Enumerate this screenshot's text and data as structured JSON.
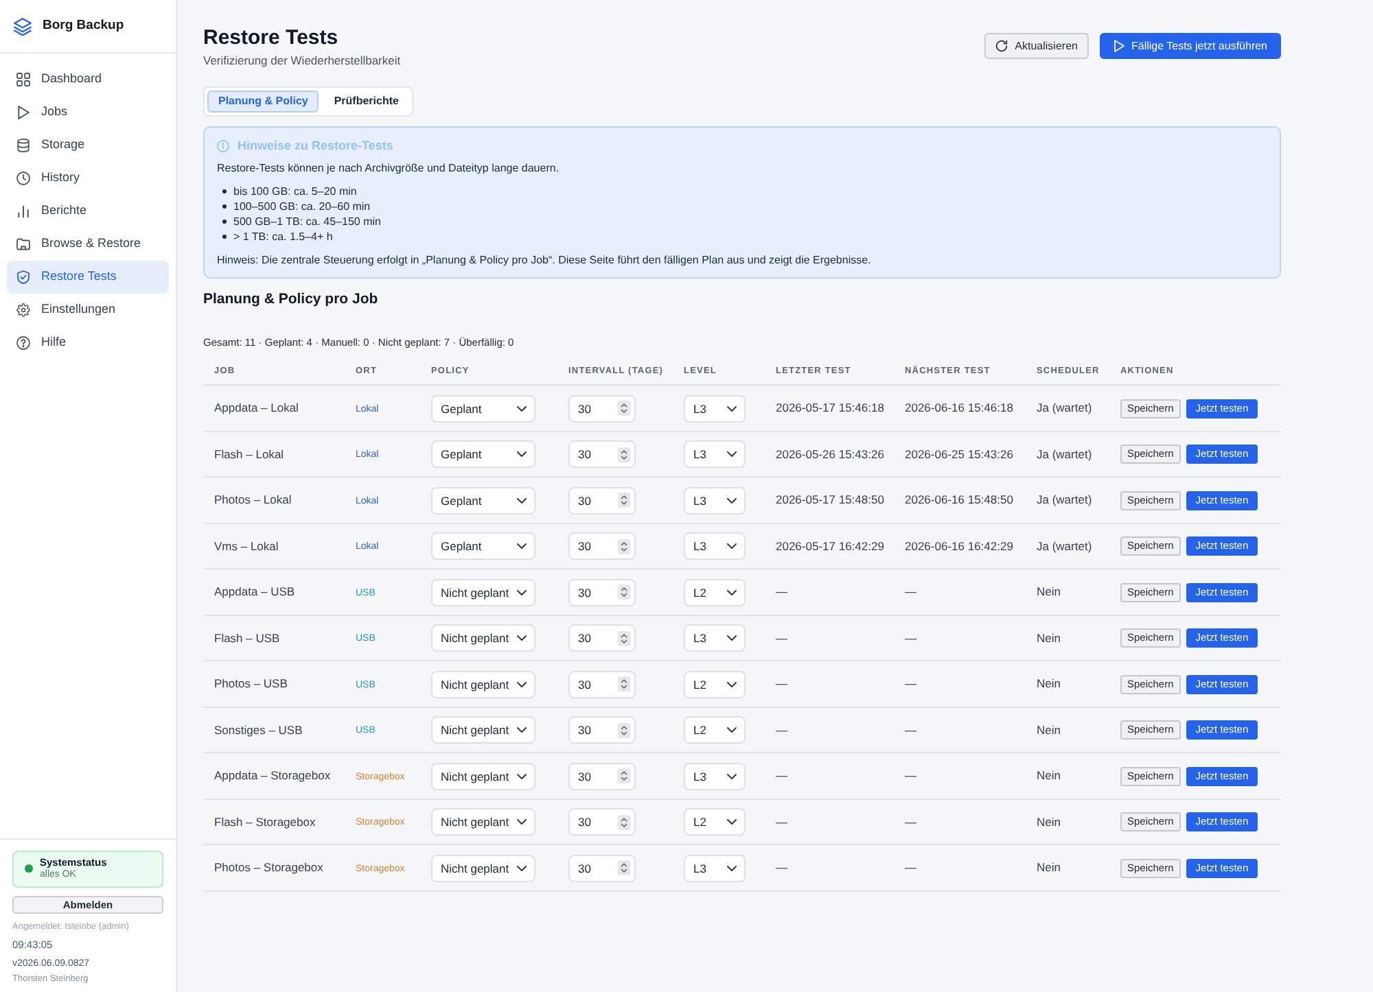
{
  "sidebar": {
    "brand": "Borg Backup",
    "items": [
      {
        "label": "Dashboard",
        "selected": false
      },
      {
        "label": "Jobs",
        "selected": false
      },
      {
        "label": "Storage",
        "selected": false
      },
      {
        "label": "History",
        "selected": false
      },
      {
        "label": "Berichte",
        "selected": false
      },
      {
        "label": "Browse & Restore",
        "selected": false
      },
      {
        "label": "Restore Tests",
        "selected": true
      },
      {
        "label": "Einstellungen",
        "selected": false
      },
      {
        "label": "Hilfe",
        "selected": false
      }
    ],
    "status": {
      "title": "Systemstatus",
      "text": "alles OK"
    },
    "logout_button": "Abmelden",
    "logged_in": "Angemeldet: tsteinbe (admin)",
    "clock": "09:43:05",
    "version": "v2026.06.09.0827",
    "author": "Thorsten Steinberg"
  },
  "header": {
    "title": "Restore Tests",
    "subtitle": "Verifizierung der Wiederherstellbarkeit",
    "buttons": [
      {
        "label": "Aktualisieren",
        "kind": "refresh"
      },
      {
        "label": "Fällige Tests jetzt ausführen",
        "kind": "run"
      }
    ]
  },
  "tabs": [
    {
      "label": "Planung & Policy",
      "selected": true
    },
    {
      "label": "Prüfberichte",
      "selected": false
    }
  ],
  "notice": {
    "title": "Hinweise zu Restore-Tests",
    "intro": "Restore-Tests können je nach Archivgröße und Dateityp lange dauern.",
    "items": [
      "bis 100 GB: ca. 5–20 min",
      "100–500 GB: ca. 20–60 min",
      "500 GB–1 TB: ca. 45–150 min",
      "> 1 TB: ca. 1.5–4+ h"
    ],
    "note": "Hinweis: Die zentrale Steuerung erfolgt in „Planung & Policy pro Job“. Diese Seite führt den fälligen Plan aus und zeigt die Ergebnisse."
  },
  "section_title": "Planung & Policy pro Job",
  "summary": "Gesamt: 11 · Geplant: 4 · Manuell: 0 · Nicht geplant: 7 · Überfällig: 0",
  "table": {
    "columns": [
      "JOB",
      "ORT",
      "POLICY",
      "INTERVALL (TAGE)",
      "LEVEL",
      "LETZTER TEST",
      "NÄCHSTER TEST",
      "SCHEDULER",
      "AKTIONEN"
    ],
    "rows": [
      {
        "job": "Appdata – Lokal",
        "location": {
          "label": "Lokal",
          "color": "#2563eb"
        },
        "policy": "Geplant",
        "interval": "30",
        "test_level": "L3",
        "last_test": "2026-05-17 15:46:18",
        "next_test": "2026-06-16 15:46:18",
        "scheduler": "Ja (wartet)",
        "save": "Speichern",
        "run": "Jetzt testen"
      },
      {
        "job": "Flash – Lokal",
        "location": {
          "label": "Lokal",
          "color": "#2563eb"
        },
        "policy": "Geplant",
        "interval": "30",
        "test_level": "L3",
        "last_test": "2026-05-26 15:43:26",
        "next_test": "2026-06-25 15:43:26",
        "scheduler": "Ja (wartet)",
        "save": "Speichern",
        "run": "Jetzt testen"
      },
      {
        "job": "Photos – Lokal",
        "location": {
          "label": "Lokal",
          "color": "#2563eb"
        },
        "policy": "Geplant",
        "interval": "30",
        "test_level": "L3",
        "last_test": "2026-05-17 15:48:50",
        "next_test": "2026-06-16 15:48:50",
        "scheduler": "Ja (wartet)",
        "save": "Speichern",
        "run": "Jetzt testen"
      },
      {
        "job": "Vms – Lokal",
        "location": {
          "label": "Lokal",
          "color": "#2563eb"
        },
        "policy": "Geplant",
        "interval": "30",
        "test_level": "L3",
        "last_test": "2026-05-17 16:42:29",
        "next_test": "2026-06-16 16:42:29",
        "scheduler": "Ja (wartet)",
        "save": "Speichern",
        "run": "Jetzt testen"
      },
      {
        "job": "Appdata – USB",
        "location": {
          "label": "USB",
          "color": "#1c98d4"
        },
        "policy": "Nicht geplant",
        "interval": "30",
        "test_level": "L2",
        "last_test": "—",
        "next_test": "—",
        "scheduler": "Nein",
        "save": "Speichern",
        "run": "Jetzt testen"
      },
      {
        "job": "Flash – USB",
        "location": {
          "label": "USB",
          "color": "#1c98d4"
        },
        "policy": "Nicht geplant",
        "interval": "30",
        "test_level": "L3",
        "last_test": "—",
        "next_test": "—",
        "scheduler": "Nein",
        "save": "Speichern",
        "run": "Jetzt testen"
      },
      {
        "job": "Photos – USB",
        "location": {
          "label": "USB",
          "color": "#1c98d4"
        },
        "policy": "Nicht geplant",
        "interval": "30",
        "test_level": "L2",
        "last_test": "—",
        "next_test": "—",
        "scheduler": "Nein",
        "save": "Speichern",
        "run": "Jetzt testen"
      },
      {
        "job": "Sonstiges – USB",
        "location": {
          "label": "USB",
          "color": "#1c98d4"
        },
        "policy": "Nicht geplant",
        "interval": "30",
        "test_level": "L2",
        "last_test": "—",
        "next_test": "—",
        "scheduler": "Nein",
        "save": "Speichern",
        "run": "Jetzt testen"
      },
      {
        "job": "Appdata – Storagebox",
        "location": {
          "label": "Storagebox",
          "color": "#d9822b"
        },
        "policy": "Nicht geplant",
        "interval": "30",
        "test_level": "L3",
        "last_test": "—",
        "next_test": "—",
        "scheduler": "Nein",
        "save": "Speichern",
        "run": "Jetzt testen"
      },
      {
        "job": "Flash – Storagebox",
        "location": {
          "label": "Storagebox",
          "color": "#d9822b"
        },
        "policy": "Nicht geplant",
        "interval": "30",
        "test_level": "L2",
        "last_test": "—",
        "next_test": "—",
        "scheduler": "Nein",
        "save": "Speichern",
        "run": "Jetzt testen"
      },
      {
        "job": "Photos – Storagebox",
        "location": {
          "label": "Storagebox",
          "color": "#d9822b"
        },
        "policy": "Nicht geplant",
        "interval": "30",
        "test_level": "L3",
        "last_test": "—",
        "next_test": "—",
        "scheduler": "Nein",
        "save": "Speichern",
        "run": "Jetzt testen"
      }
    ]
  }
}
